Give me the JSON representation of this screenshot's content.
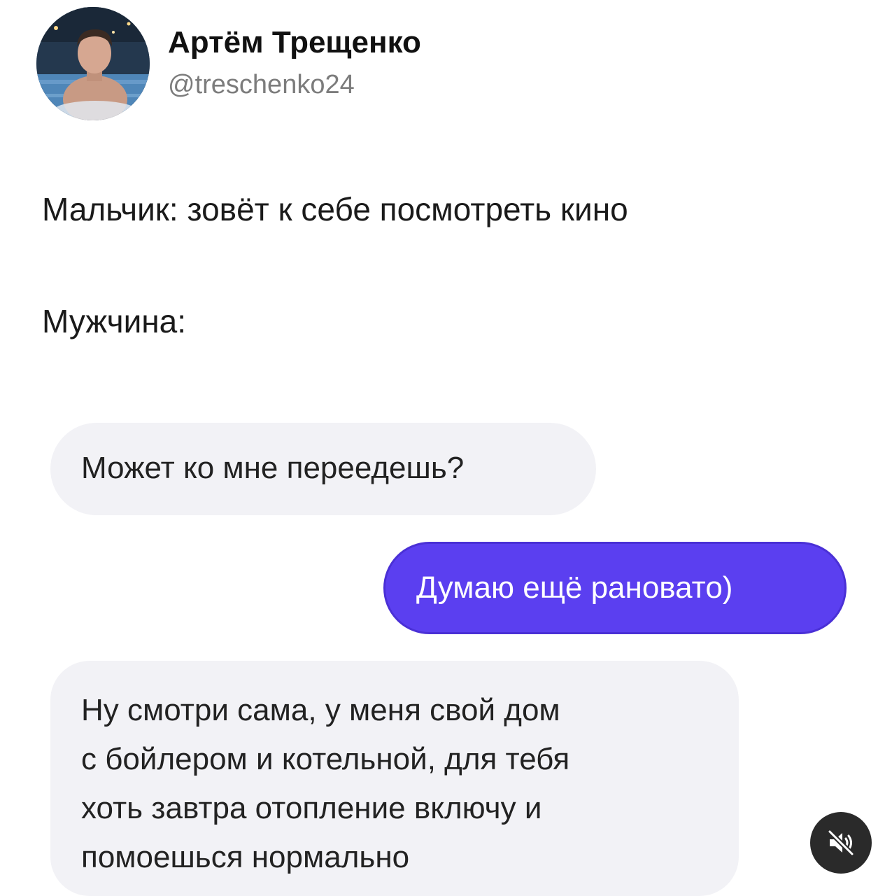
{
  "author": {
    "name": "Артём Трещенко",
    "handle": "@treschenko24"
  },
  "tweet": {
    "lines": [
      "Мальчик: зовёт к себе посмотреть кино",
      "Мужчина:"
    ]
  },
  "messages": [
    {
      "direction": "incoming",
      "lines": [
        "Может ко мне переедешь?"
      ]
    },
    {
      "direction": "outgoing",
      "lines": [
        "Думаю ещё рановато)"
      ]
    },
    {
      "direction": "incoming",
      "lines": [
        "Ну смотри сама, у меня свой дом",
        "с бойлером и котельной, для тебя",
        "хоть завтра отопление включу и",
        "помоешься нормально"
      ]
    }
  ],
  "colors": {
    "incoming_bubble": "#f2f2f6",
    "outgoing_bubble": "#5b3ff0",
    "handle_text": "#7c7c7c",
    "mute_button": "#2a2a2a"
  },
  "icons": {
    "mute_button": "speaker-muted-icon"
  }
}
